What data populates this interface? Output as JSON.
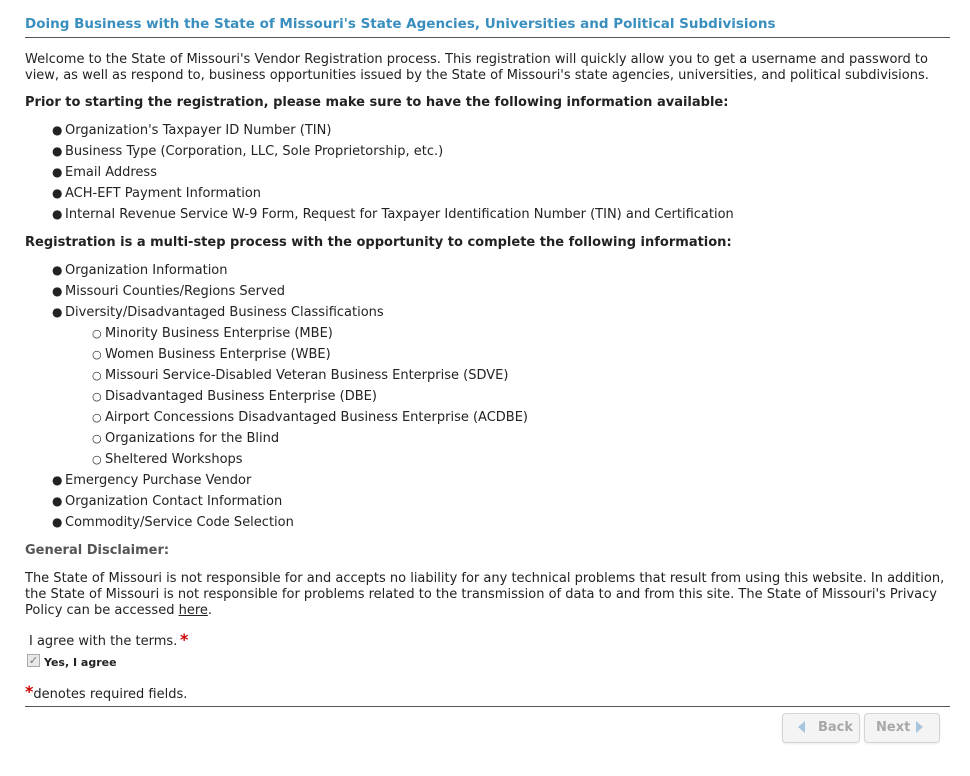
{
  "page": {
    "title": "Doing Business with the State of Missouri's State Agencies, Universities and Political Subdivisions",
    "intro": "Welcome to the State of Missouri's Vendor Registration process. This registration will quickly allow you to get a username and password to view, as well as respond to, business opportunities issued by the State of Missouri's state agencies, universities, and political subdivisions.",
    "prereq_heading": "Prior to starting the registration, please make sure to have the following information available:",
    "prereq_items": [
      "Organization's Taxpayer ID Number (TIN)",
      "Business Type (Corporation, LLC, Sole Proprietorship, etc.)",
      "Email Address",
      "ACH-EFT Payment Information",
      "Internal Revenue Service W-9 Form, Request for Taxpayer Identification Number (TIN) and Certification"
    ],
    "steps_heading": "Registration is a multi-step process with the opportunity to complete the following information:",
    "steps_items": [
      "Organization Information",
      "Missouri Counties/Regions Served",
      "Diversity/Disadvantaged Business Classifications"
    ],
    "diversity_items": [
      "Minority Business Enterprise (MBE)",
      "Women Business Enterprise (WBE)",
      "Missouri Service-Disabled Veteran Business Enterprise (SDVE)",
      "Disadvantaged Business Enterprise (DBE)",
      "Airport Concessions Disadvantaged Business Enterprise (ACDBE)",
      "Organizations for the Blind",
      "Sheltered Workshops"
    ],
    "steps_items_after": [
      "Emergency Purchase Vendor",
      "Organization Contact Information",
      "Commodity/Service Code Selection"
    ],
    "disclaimer_heading": "General Disclaimer:",
    "disclaimer_text": "The State of Missouri is not responsible for and accepts no liability for any technical problems that result from using this website. In addition, the State of Missouri is not responsible for problems related to the transmission of data to and from this site. The State of Missouri's Privacy Policy can be accessed ",
    "disclaimer_link": "here",
    "disclaimer_end": ".",
    "agree_label": "I agree with the terms.",
    "required_star": "*",
    "checkbox_label": "Yes, I agree",
    "checkbox_checked": true,
    "required_note": "denotes required fields."
  },
  "buttons": {
    "back": "Back",
    "next": "Next"
  },
  "icons": {
    "back": "chevron-left-icon",
    "next": "chevron-right-icon",
    "check": "checkmark-icon"
  },
  "colors": {
    "title": "#3a8fbf",
    "required": "#cc0000",
    "button_icon": "#a7c6de"
  }
}
